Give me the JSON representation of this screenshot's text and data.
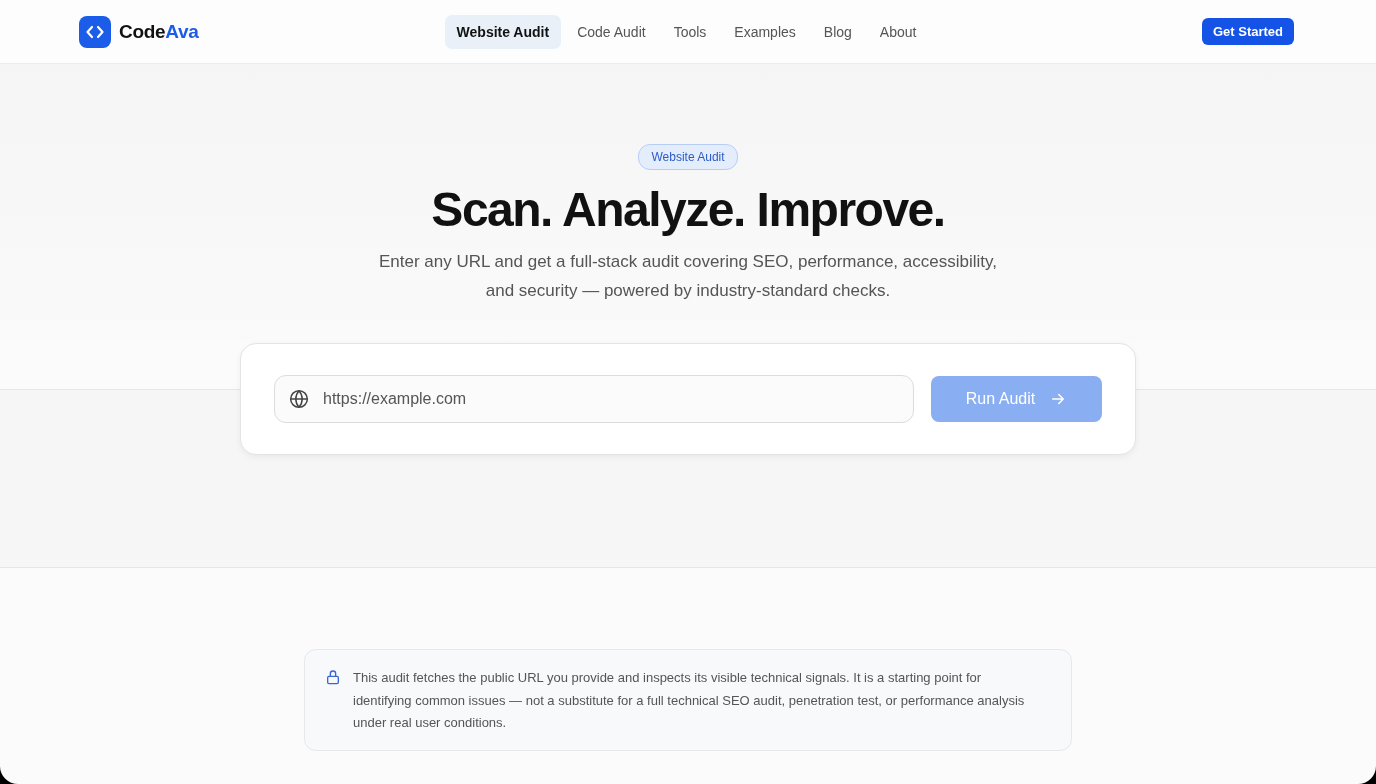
{
  "brand": {
    "name": "Code",
    "accent": "Ava"
  },
  "nav": [
    {
      "label": "Website Audit",
      "selected": true
    },
    {
      "label": "Code Audit",
      "selected": false
    },
    {
      "label": "Tools",
      "selected": false
    },
    {
      "label": "Examples",
      "selected": false
    },
    {
      "label": "Blog",
      "selected": false
    },
    {
      "label": "About",
      "selected": false
    }
  ],
  "cta": "Get Started",
  "hero": {
    "badge": "Website Audit",
    "title": "Scan. Analyze. Improve.",
    "subtitle": "Enter any URL and get a full-stack audit covering SEO, performance, accessibility, and security — powered by industry-standard checks."
  },
  "audit_form": {
    "url_field": {
      "placeholder": "https://example.com"
    },
    "run_button": {
      "label": "Run Audit",
      "disabled": true
    }
  },
  "notice": "This audit fetches the public URL you provide and inspects its visible technical signals. It is a starting point for identifying common issues — not a substitute for a full technical SEO audit, penetration test, or performance analysis under real user conditions."
}
